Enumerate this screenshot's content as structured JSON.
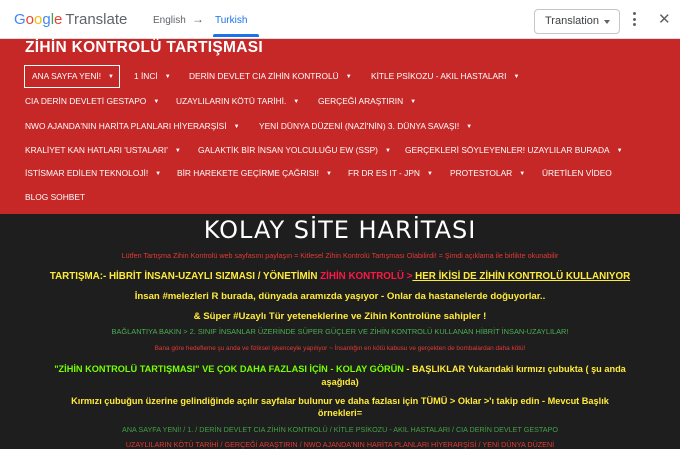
{
  "translate_bar": {
    "logo_g": [
      "G",
      "o",
      "o",
      "g",
      "l",
      "e"
    ],
    "logo_colors": [
      "#4285f4",
      "#ea4335",
      "#fbbc05",
      "#4285f4",
      "#34a853",
      "#ea4335"
    ],
    "logo_word": "Translate",
    "source_lang": "English",
    "arrow": "→",
    "target_lang": "Turkish",
    "select_label": "Translation",
    "menu_icon": "more-vert-icon",
    "close_icon": "close-icon",
    "close_glyph": "✕"
  },
  "header": {
    "title": "ZİHİN KONTROLÜ TARTIŞMASI",
    "dropdown_glyph": "▼",
    "nav": [
      {
        "label": "ANA SAYFA YENİ!",
        "dd": true
      },
      {
        "label": "1 İNCİ",
        "dd": true
      },
      {
        "label": "DERİN DEVLET CIA ZİHİN KONTROLÜ",
        "dd": true
      },
      {
        "label": "KİTLE PSİKOZU - AKIL HASTALARI",
        "dd": true
      },
      {
        "label": "CIA DERİN DEVLETİ GESTAPO",
        "dd": true
      },
      {
        "label": "UZAYLILARIN KÖTÜ TARİHİ.",
        "dd": true
      },
      {
        "label": "GERÇEĞİ ARAŞTIRIN",
        "dd": true
      },
      {
        "label": "NWO AJANDA'NIN HARİTA PLANLARI HİYERARŞİSİ",
        "dd": true
      },
      {
        "label": "YENİ DÜNYA DÜZENİ (NAZİ'NİN) 3. DÜNYA SAVAŞI!",
        "dd": true
      },
      {
        "label": "KRALİYET KAN HATLARI 'USTALARI'",
        "dd": true
      },
      {
        "label": "GALAKTİK BİR İNSAN YOLCULUĞU EW (SSP)",
        "dd": true
      },
      {
        "label": "GERÇEKLERİ SÖYLEYENLER! UZAYLILAR BURADA",
        "dd": true
      },
      {
        "label": "İSTİSMAR EDİLEN TEKNOLOJİ!",
        "dd": true
      },
      {
        "label": "BİR HAREKETE GEÇİRME ÇAĞRISI!",
        "dd": true
      },
      {
        "label": "FR DR ES IT - JPN",
        "dd": true
      },
      {
        "label": "PROTESTOLAR",
        "dd": true
      },
      {
        "label": "ÜRETİLEN VİDEO",
        "dd": false
      },
      {
        "label": "BLOG SOHBET",
        "dd": false
      }
    ]
  },
  "content": {
    "sitemap_title": "KOLAY SİTE HARİTASI",
    "notice": "Lütfen Tartışma Zihin Kontrolü web sayfasını paylaşın = Kitlesel Zihin Kontrolü Tartışması Olabilirdi! = Şimdi açıklama ile birlikte okunabilir",
    "line1_a": "TARTIŞMA:- HİBRİT İNSAN-UZAYLI SIZMASI / YÖNETİMİN ",
    "line1_b": "ZİHİN KONTROLÜ >",
    "line1_c": " HER İKİSİ DE ZİHİN KONTROLÜ KULLANIYOR",
    "line2": "İnsan #melezleri R burada, dünyada aramızda yaşıyor - Onlar da hastanelerde doğuyorlar..",
    "line3": "& Süper #Uzaylı Tür yeteneklerine ve Zihin Kontrolüne sahipler !",
    "line4": "BAĞLANTIYA BAKIN > 2. SINIF İNSANLAR ÜZERİNDE SÜPER GÜÇLER VE ZİHİN KONTROLÜ KULLANAN HİBRİT İNSAN-UZAYLILAR!",
    "line5": "Bana göre hedefleme şu anda ve fiziksel işkenceyle yapılıyor ~ İnsanlığın en kötü kabusu ve gerçekten de bombalardan daha kötü!",
    "line6_a": "\"ZİHİN KONTROLÜ TARTIŞMASI\" VE ÇOK DAHA FAZLASI İÇİN - KOLAY GÖRÜN",
    "line6_b": " - BAŞLIKLAR Yukarıdaki kırmızı çubukta ( şu anda",
    "line6_c": "aşağıda)",
    "line7_a": "Kırmızı çubuğun üzerine gelindiğinde açılır sayfalar bulunur ve daha fazlası için TÜMÜ > Oklar >'ı takip edin - Mevcut Başlık",
    "line7_b": "örnekleri=",
    "line8": "ANA SAYFA YENİ! / 1. / DERİN DEVLET CIA ZİHİN KONTROLÜ / KİTLE PSİKOZU - AKIL HASTALARI / CIA DERİN DEVLET GESTAPO",
    "line9": "UZAYLILARIN KÖTÜ TARİHİ / GERÇEĞİ ARAŞTIRIN / NWO AJANDA'NIN HARİTA PLANLARI HİYERARŞİSİ / YENİ DÜNYA DÜZENİ"
  }
}
